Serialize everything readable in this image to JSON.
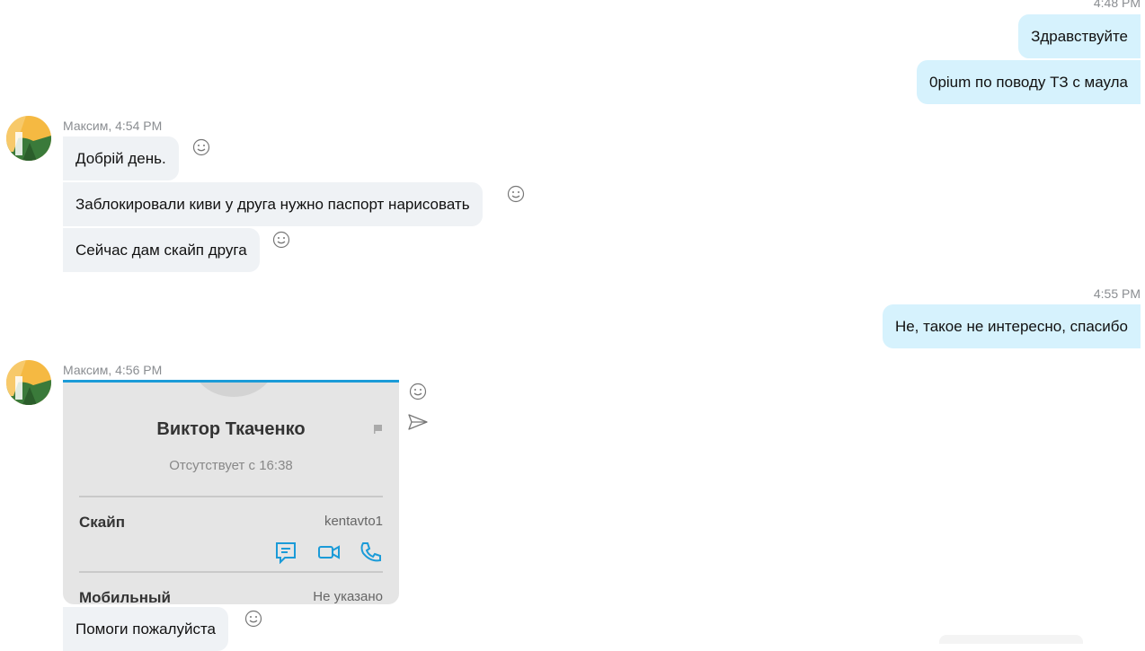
{
  "messages": {
    "out_group_1": {
      "timestamp": "4:48 PM",
      "lines": [
        "Здравствуйте",
        "0pium по поводу ТЗ с маула"
      ]
    },
    "in_group_1": {
      "header": "Максим, 4:54 PM",
      "lines": [
        "Добрій день.",
        "Заблокировали киви у друга нужно паспорт нарисовать",
        "Сейчас дам скайп друга"
      ]
    },
    "out_group_2": {
      "timestamp": "4:55 PM",
      "lines": [
        "Не, такое не интересно, спасибо"
      ]
    },
    "in_group_2": {
      "header": "Максим, 4:56 PM",
      "image": {
        "contact_name": "Виктор Ткаченко",
        "contact_status": "Отсутствует с 16:38",
        "skype_label": "Скайп",
        "skype_value": "kentavto1",
        "mobile_label": "Мобильный",
        "mobile_value": "Не указано"
      },
      "lines": [
        "Помоги пожалуйста"
      ]
    }
  },
  "icons": {
    "reaction": "smiley-icon",
    "forward": "send-icon",
    "chat": "chat-icon",
    "video": "video-camera-icon",
    "call": "phone-icon"
  },
  "colors": {
    "outgoing_bubble": "#d6f2fd",
    "incoming_bubble": "#eff2f5",
    "accent": "#1b9bd8",
    "timestamp": "#8a8d91"
  }
}
